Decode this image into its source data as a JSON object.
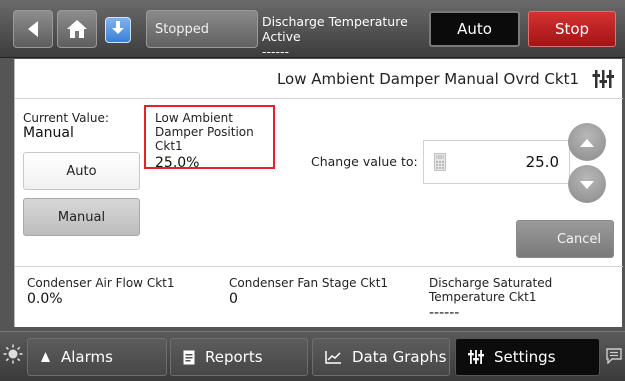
{
  "header": {
    "status": "Stopped",
    "discharge_title": "Discharge Temperature Active",
    "discharge_value": "------",
    "auto_label": "Auto",
    "stop_label": "Stop"
  },
  "panel": {
    "title": "Low Ambient Damper Manual Ovrd Ckt1",
    "current_label": "Current Value:",
    "current_value": "Manual",
    "auto_button": "Auto",
    "manual_button": "Manual",
    "position_label": "Low Ambient Damper Position Ckt1",
    "position_value": "25.0%",
    "change_label": "Change value to:",
    "input_value": "25.0",
    "cancel_label": "Cancel"
  },
  "info": [
    {
      "label": "Condenser Air Flow Ckt1",
      "value": "0.0%"
    },
    {
      "label": "Condenser Fan Stage Ckt1",
      "value": "0"
    },
    {
      "label": "Discharge Saturated Temperature Ckt1",
      "value": "------"
    }
  ],
  "footer": {
    "tabs": [
      {
        "label": "Alarms",
        "icon": "bell-icon"
      },
      {
        "label": "Reports",
        "icon": "document-icon"
      },
      {
        "label": "Data Graphs",
        "icon": "graph-icon"
      },
      {
        "label": "Settings",
        "icon": "settings-icon",
        "active": true
      }
    ]
  },
  "colors": {
    "stop": "#b51f1f",
    "highlight_border": "#e3232b",
    "active_tab": "#0c0c0c"
  }
}
